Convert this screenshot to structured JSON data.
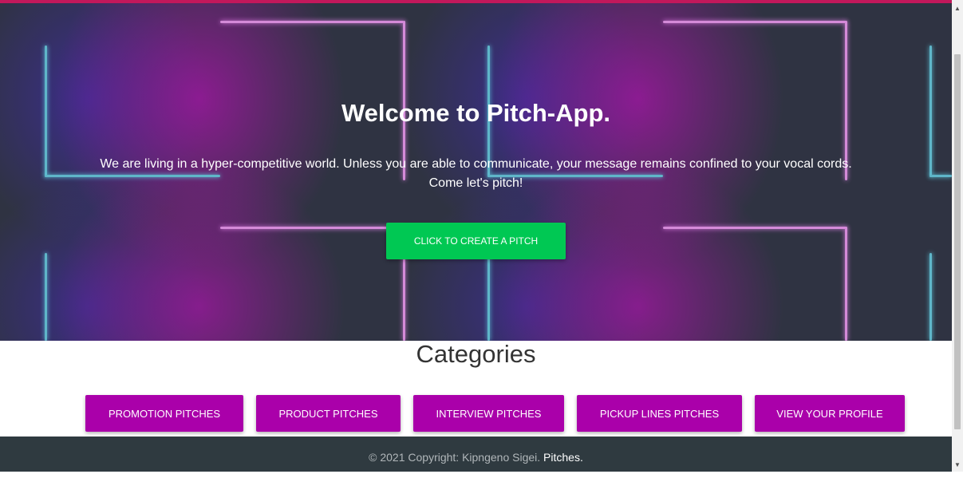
{
  "hero": {
    "title": "Welcome to Pitch-App.",
    "text_line1": "We are living in a hyper-competitive world. Unless you are able to communicate, your message remains confined to your vocal cords.",
    "text_line2": "Come let's pitch!",
    "cta_label": "Click to create a pitch"
  },
  "categories": {
    "heading": "Categories",
    "buttons": [
      {
        "label": "Promotion Pitches"
      },
      {
        "label": "Product Pitches"
      },
      {
        "label": "Interview Pitches"
      },
      {
        "label": "Pickup Lines Pitches"
      },
      {
        "label": "View your profile"
      }
    ]
  },
  "footer": {
    "copyright": "© 2021 Copyright: Kipngeno Sigei.",
    "link": "Pitches."
  },
  "colors": {
    "accent_top": "#c2185b",
    "cta_green": "#00c853",
    "category_purple": "#aa00aa",
    "footer_bg": "#2f3a40"
  },
  "icons": {
    "scroll_up": "scroll-up-arrow-icon",
    "scroll_down": "scroll-down-arrow-icon"
  }
}
